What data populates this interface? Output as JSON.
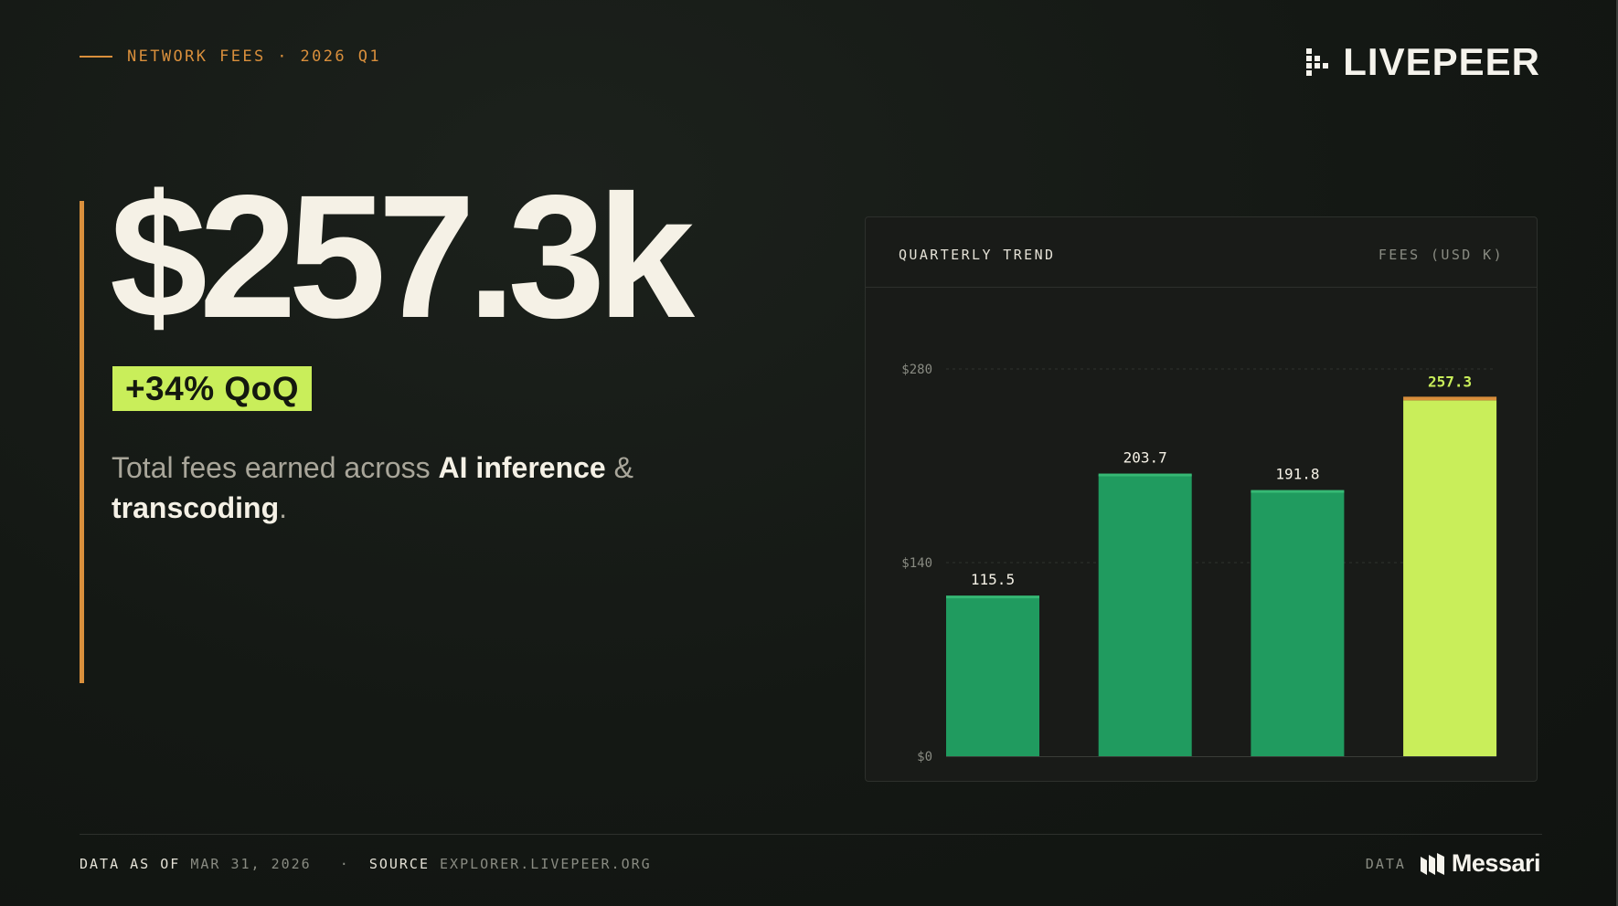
{
  "header": {
    "eyebrow": "NETWORK FEES · 2026 Q1",
    "logo_word": "LIVEPEER"
  },
  "hero": {
    "value": "$257.3k",
    "change_badge": "+34% QoQ",
    "desc_part1": "Total fees earned across ",
    "desc_hl1": "AI inference",
    "desc_part2": " & ",
    "desc_hl2": "transcoding",
    "desc_part3": "."
  },
  "panel": {
    "title": "QUARTERLY TREND",
    "unit": "FEES (USD K)"
  },
  "chart_data": {
    "type": "bar",
    "title": "QUARTERLY TREND",
    "ylabel": "FEES (USD K)",
    "xlabel": "",
    "categories": [
      "",
      "",
      "",
      ""
    ],
    "values": [
      115.5,
      203.7,
      191.8,
      257.3
    ],
    "value_labels": [
      "115.5",
      "203.7",
      "191.8",
      "257.3"
    ],
    "ylim": [
      0,
      280
    ],
    "yticks": [
      0,
      140,
      280
    ],
    "ytick_labels": [
      "$0",
      "$140",
      "$280"
    ],
    "grid": true,
    "colors": {
      "bar": "#209b5f",
      "bar_cap": "#36b874",
      "highlight": "#c9ee5a",
      "highlight_cap": "#d98f3c",
      "highlight_label": "#c9ee5a",
      "label": "#f5f1e6",
      "tick": "#898b82",
      "grid": "#30332e"
    }
  },
  "footer": {
    "asof_label": "DATA AS OF",
    "asof_value": "MAR 31, 2026",
    "sep": "·",
    "source_label": "SOURCE",
    "source_value": "EXPLORER.LIVEPEER.ORG",
    "data_label": "DATA",
    "data_brand": "Messari"
  },
  "colors": {
    "accent": "#d98f3c",
    "lime": "#c9ee5a",
    "green": "#209b5f",
    "background": "#141814"
  }
}
